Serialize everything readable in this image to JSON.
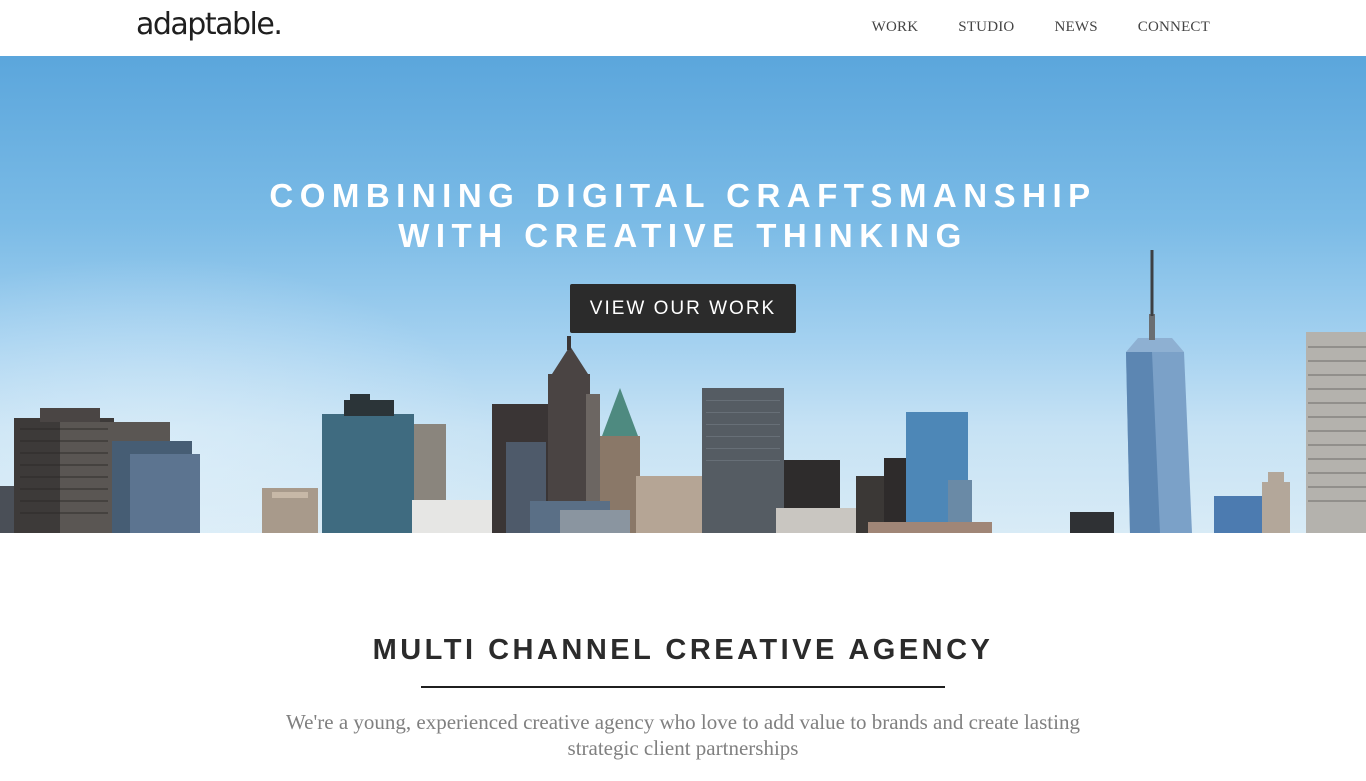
{
  "header": {
    "logo": "adaptable.",
    "nav": [
      {
        "label": "WORK"
      },
      {
        "label": "STUDIO"
      },
      {
        "label": "NEWS"
      },
      {
        "label": "CONNECT"
      }
    ]
  },
  "hero": {
    "title_line1": "COMBINING DIGITAL CRAFTSMANSHIP",
    "title_line2": "WITH CREATIVE THINKING",
    "cta_label": "VIEW OUR WORK"
  },
  "intro": {
    "title": "MULTI CHANNEL CREATIVE AGENCY",
    "text": "We're a young, experienced creative agency who love to add value to brands and create lasting strategic client partnerships"
  },
  "colors": {
    "cta_background": "#2b2b2b",
    "sky_top": "#5ba6dc",
    "sky_bottom": "#d8ebf6",
    "body_text": "#808080",
    "heading_text": "#2b2b2b"
  }
}
